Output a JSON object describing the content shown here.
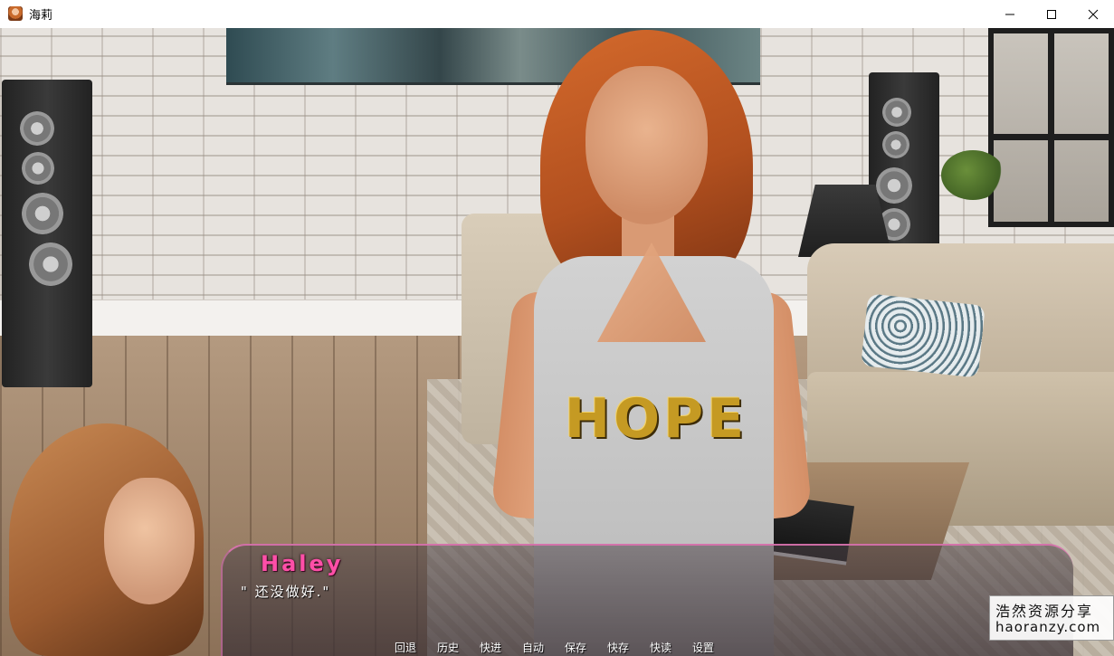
{
  "window": {
    "title": "海莉",
    "icon": "app-portrait-icon",
    "controls": [
      "minimize-icon",
      "maximize-icon",
      "close-icon"
    ]
  },
  "shirt": {
    "print": "HOPE"
  },
  "dialogue": {
    "speaker": "Haley",
    "text": "\" 还没做好.\"",
    "speaker_color": "#ff4fa8"
  },
  "quick_menu": {
    "items": [
      {
        "label": "回退"
      },
      {
        "label": "历史"
      },
      {
        "label": "快进"
      },
      {
        "label": "自动"
      },
      {
        "label": "保存"
      },
      {
        "label": "快存"
      },
      {
        "label": "快读"
      },
      {
        "label": "设置"
      }
    ]
  },
  "watermark": {
    "cn": "浩然资源分享",
    "en": "haoranzy.com"
  }
}
